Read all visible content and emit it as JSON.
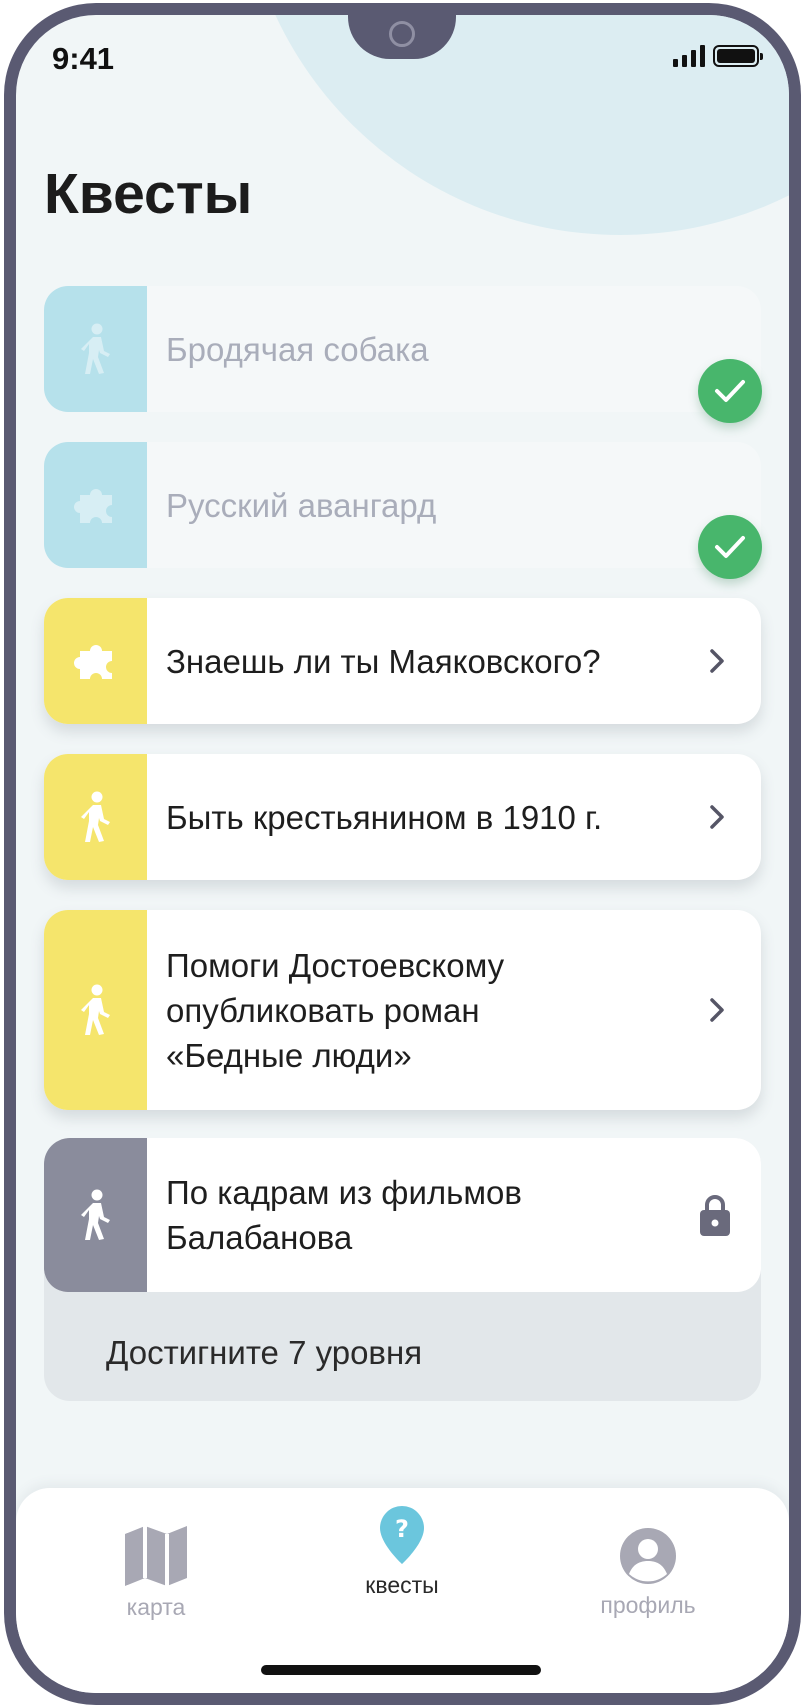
{
  "status_bar": {
    "time": "9:41"
  },
  "page": {
    "title": "Квесты"
  },
  "quests": [
    {
      "title": "Бродячая собака",
      "icon": "walking-person-icon",
      "state": "completed",
      "strip_color": "#b6e1eb"
    },
    {
      "title": "Русский авангард",
      "icon": "puzzle-icon",
      "state": "completed",
      "strip_color": "#b6e1eb"
    },
    {
      "title": "Знаешь ли ты Маяковского?",
      "icon": "puzzle-icon",
      "state": "available",
      "strip_color": "#f5e56c"
    },
    {
      "title": "Быть крестьянином в 1910 г.",
      "icon": "walking-person-icon",
      "state": "available",
      "strip_color": "#f5e56c"
    },
    {
      "title": "Помоги Достоевскому\nопубликовать роман\n«Бедные люди»",
      "icon": "walking-person-icon",
      "state": "available",
      "strip_color": "#f5e56c"
    },
    {
      "title": "По кадрам из фильмов\nБалабанова",
      "icon": "walking-person-icon",
      "state": "locked",
      "strip_color": "#8a8c9c",
      "locked_note": "Достигните 7 уровня"
    }
  ],
  "tabbar": {
    "tabs": [
      {
        "label": "карта",
        "icon": "map-icon",
        "active": false
      },
      {
        "label": "квесты",
        "icon": "quest-pin-icon",
        "active": true
      },
      {
        "label": "профиль",
        "icon": "profile-icon",
        "active": false
      }
    ]
  },
  "colors": {
    "completed_check": "#48b66c",
    "active_tab_icon": "#6bc6dd",
    "inactive_tab": "#a8a8b4"
  }
}
